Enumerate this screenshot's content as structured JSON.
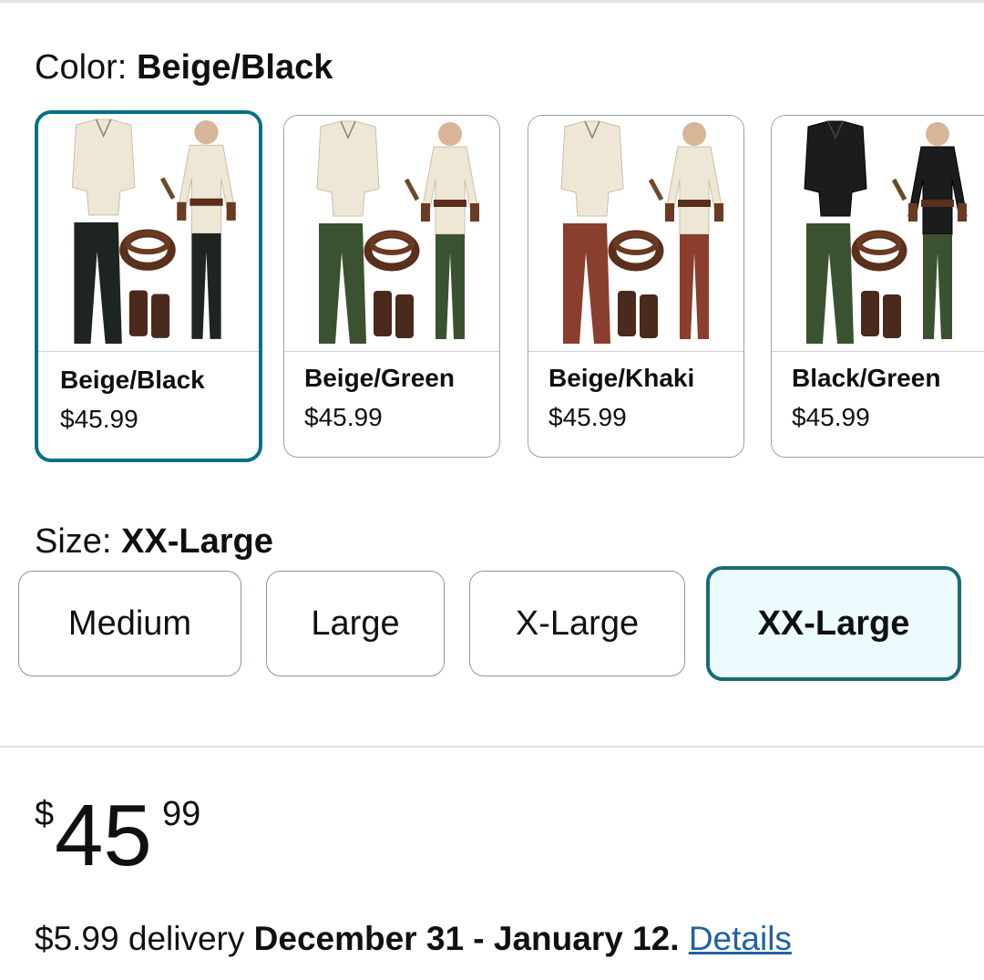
{
  "color": {
    "label": "Color:",
    "selected": "Beige/Black",
    "options": [
      {
        "name": "Beige/Black",
        "price": "$45.99",
        "shirt": "#efe7d6",
        "pants": "#1e2420"
      },
      {
        "name": "Beige/Green",
        "price": "$45.99",
        "shirt": "#efe7d6",
        "pants": "#3a5230"
      },
      {
        "name": "Beige/Khaki",
        "price": "$45.99",
        "shirt": "#efe7d6",
        "pants": "#8a3e2e"
      },
      {
        "name": "Black/Green",
        "price": "$45.99",
        "shirt": "#1c1c1c",
        "pants": "#3a5230"
      }
    ]
  },
  "size": {
    "label": "Size:",
    "selected": "XX-Large",
    "options": [
      "Medium",
      "Large",
      "X-Large",
      "XX-Large"
    ]
  },
  "price": {
    "symbol": "$",
    "whole": "45",
    "fraction": "99"
  },
  "delivery": {
    "fee": "$5.99 delivery",
    "dates": "December 31 - January 12",
    "link": "Details"
  },
  "colors": {
    "accent": "#007185",
    "selected_bg": "#ecfbfd",
    "link": "#2162a1"
  }
}
